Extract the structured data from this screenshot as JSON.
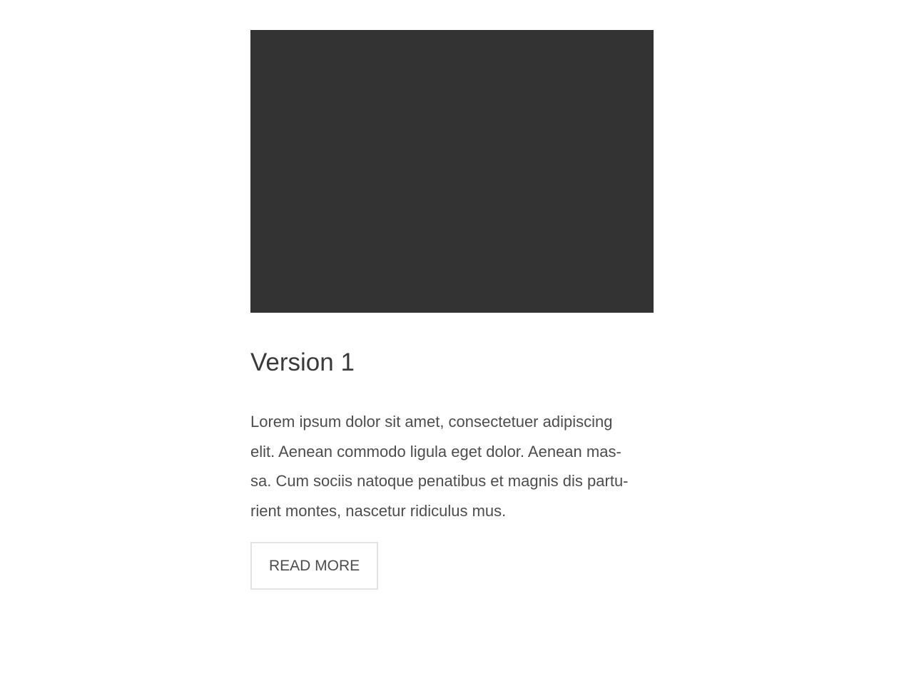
{
  "card": {
    "title": "Version 1",
    "body_lines": [
      "Lorem ipsum dolor sit amet, consectetuer adipiscing",
      "elit. Aenean commodo ligula eget dolor. Aenean mas-",
      "sa. Cum sociis natoque penatibus et magnis dis partu-",
      "rient montes, nascetur ridiculus mus."
    ],
    "button_label": "READ MORE",
    "media_color": "#333333"
  }
}
